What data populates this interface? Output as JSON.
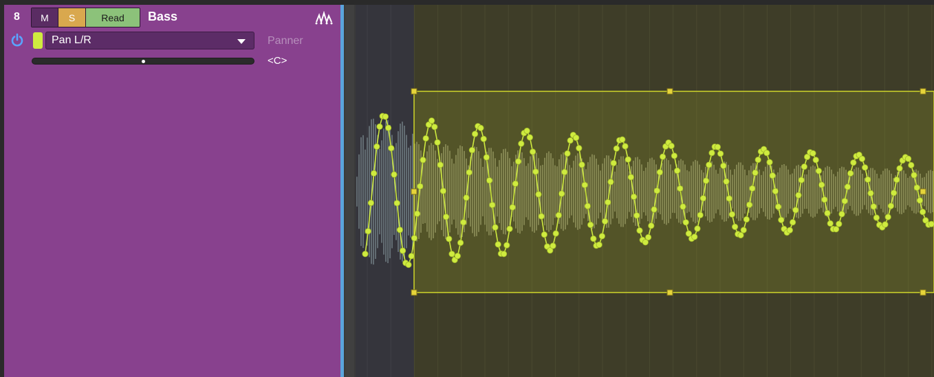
{
  "track": {
    "number": "8",
    "mute_label": "M",
    "solo_label": "S",
    "automation_mode": "Read",
    "name": "Bass"
  },
  "automation": {
    "parameter": "Pan L/R",
    "device": "Panner",
    "value": "<C>",
    "pan_position": 0.5
  },
  "icons": [
    "waveform-icon",
    "power-icon",
    "dropdown-arrow-icon"
  ],
  "colors": {
    "track_color": "#88418e",
    "automation_color": "#cfeb3f",
    "solo": "#d9a84e",
    "read": "#8cc27a",
    "divider": "#5aa4dc"
  }
}
